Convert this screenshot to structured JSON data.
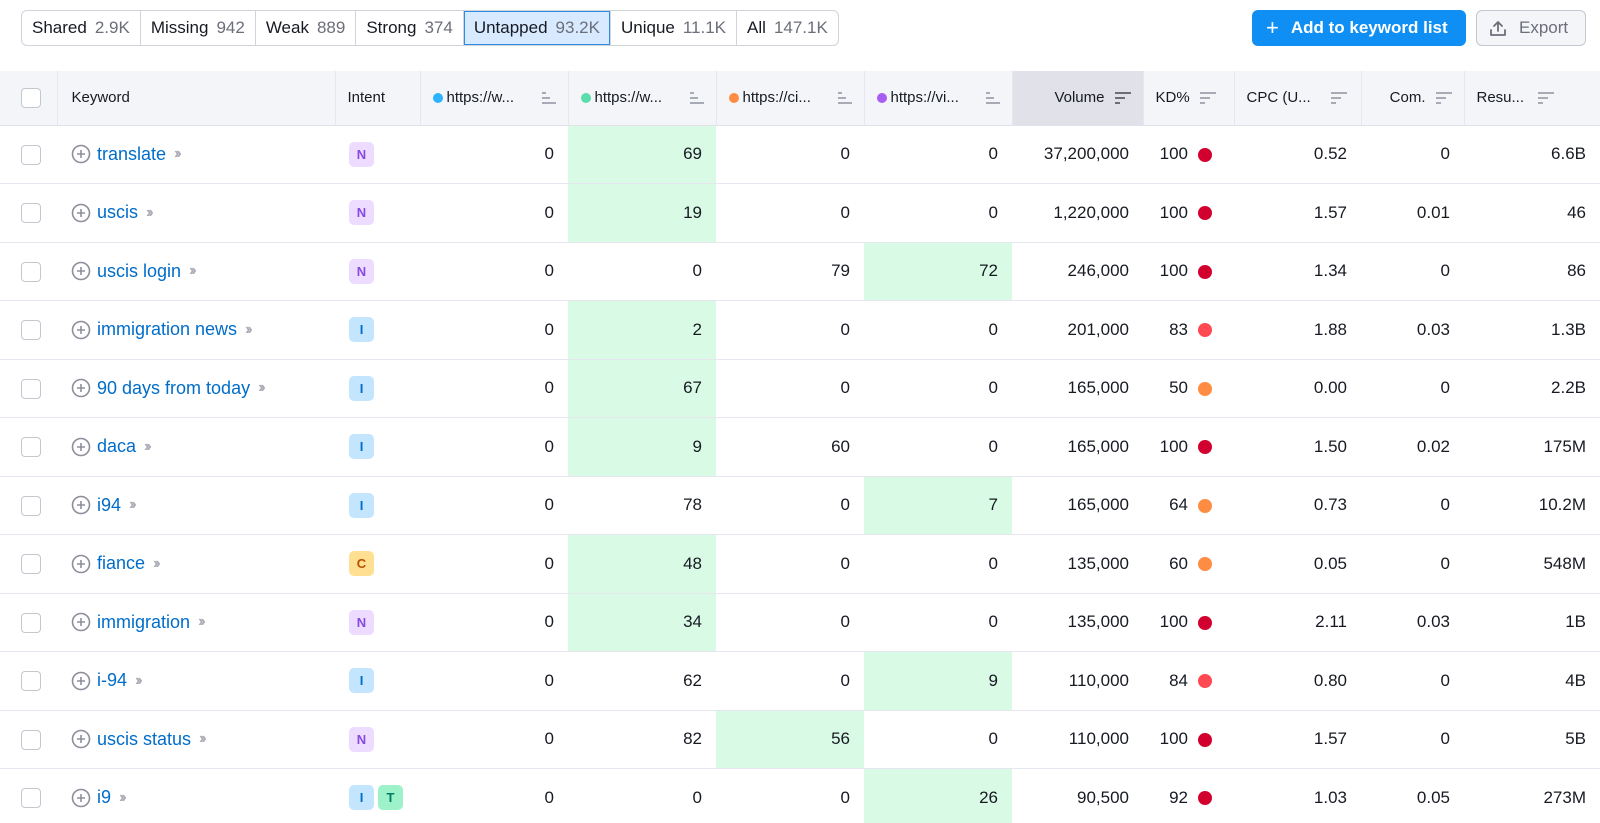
{
  "filters": [
    {
      "label": "Shared",
      "count": "2.9K",
      "active": false
    },
    {
      "label": "Missing",
      "count": "942",
      "active": false
    },
    {
      "label": "Weak",
      "count": "889",
      "active": false
    },
    {
      "label": "Strong",
      "count": "374",
      "active": false
    },
    {
      "label": "Untapped",
      "count": "93.2K",
      "active": true
    },
    {
      "label": "Unique",
      "count": "11.1K",
      "active": false
    },
    {
      "label": "All",
      "count": "147.1K",
      "active": false
    }
  ],
  "actions": {
    "add_label": "Add to keyword list",
    "add_icon": "plus-icon",
    "export_label": "Export",
    "export_icon": "upload-icon"
  },
  "colors": {
    "accent": "#0f8ff3",
    "highlight": "#d9fbe6",
    "domain1": "#2bb3ff",
    "domain2": "#59ddaa",
    "domain3": "#ff8c43",
    "domain4": "#a75cf2",
    "kd_very_hard": "#d1002f",
    "kd_hard": "#ff4953",
    "kd_difficult": "#ff8c43"
  },
  "columns": {
    "keyword": "Keyword",
    "intent": "Intent",
    "domain1": "https://w...",
    "domain2": "https://w...",
    "domain3": "https://ci...",
    "domain4": "https://vi...",
    "volume": "Volume",
    "kd": "KD%",
    "cpc": "CPC (U...",
    "com": "Com.",
    "results": "Resu..."
  },
  "rows": [
    {
      "keyword": "translate",
      "intents": [
        "N"
      ],
      "d1": "0",
      "d2": "69",
      "d3": "0",
      "d4": "0",
      "hl": 2,
      "volume": "37,200,000",
      "kd": "100",
      "kd_level": "very_hard",
      "cpc": "0.52",
      "com": "0",
      "results": "6.6B"
    },
    {
      "keyword": "uscis",
      "intents": [
        "N"
      ],
      "d1": "0",
      "d2": "19",
      "d3": "0",
      "d4": "0",
      "hl": 2,
      "volume": "1,220,000",
      "kd": "100",
      "kd_level": "very_hard",
      "cpc": "1.57",
      "com": "0.01",
      "results": "46"
    },
    {
      "keyword": "uscis login",
      "intents": [
        "N"
      ],
      "d1": "0",
      "d2": "0",
      "d3": "79",
      "d4": "72",
      "hl": 4,
      "volume": "246,000",
      "kd": "100",
      "kd_level": "very_hard",
      "cpc": "1.34",
      "com": "0",
      "results": "86"
    },
    {
      "keyword": "immigration news",
      "intents": [
        "I"
      ],
      "d1": "0",
      "d2": "2",
      "d3": "0",
      "d4": "0",
      "hl": 2,
      "volume": "201,000",
      "kd": "83",
      "kd_level": "hard",
      "cpc": "1.88",
      "com": "0.03",
      "results": "1.3B"
    },
    {
      "keyword": "90 days from today",
      "intents": [
        "I"
      ],
      "d1": "0",
      "d2": "67",
      "d3": "0",
      "d4": "0",
      "hl": 2,
      "volume": "165,000",
      "kd": "50",
      "kd_level": "difficult",
      "cpc": "0.00",
      "com": "0",
      "results": "2.2B"
    },
    {
      "keyword": "daca",
      "intents": [
        "I"
      ],
      "d1": "0",
      "d2": "9",
      "d3": "60",
      "d4": "0",
      "hl": 2,
      "volume": "165,000",
      "kd": "100",
      "kd_level": "very_hard",
      "cpc": "1.50",
      "com": "0.02",
      "results": "175M"
    },
    {
      "keyword": "i94",
      "intents": [
        "I"
      ],
      "d1": "0",
      "d2": "78",
      "d3": "0",
      "d4": "7",
      "hl": 4,
      "volume": "165,000",
      "kd": "64",
      "kd_level": "difficult",
      "cpc": "0.73",
      "com": "0",
      "results": "10.2M"
    },
    {
      "keyword": "fiance",
      "intents": [
        "C"
      ],
      "d1": "0",
      "d2": "48",
      "d3": "0",
      "d4": "0",
      "hl": 2,
      "volume": "135,000",
      "kd": "60",
      "kd_level": "difficult",
      "cpc": "0.05",
      "com": "0",
      "results": "548M"
    },
    {
      "keyword": "immigration",
      "intents": [
        "N"
      ],
      "d1": "0",
      "d2": "34",
      "d3": "0",
      "d4": "0",
      "hl": 2,
      "volume": "135,000",
      "kd": "100",
      "kd_level": "very_hard",
      "cpc": "2.11",
      "com": "0.03",
      "results": "1B"
    },
    {
      "keyword": "i-94",
      "intents": [
        "I"
      ],
      "d1": "0",
      "d2": "62",
      "d3": "0",
      "d4": "9",
      "hl": 4,
      "volume": "110,000",
      "kd": "84",
      "kd_level": "hard",
      "cpc": "0.80",
      "com": "0",
      "results": "4B"
    },
    {
      "keyword": "uscis status",
      "intents": [
        "N"
      ],
      "d1": "0",
      "d2": "82",
      "d3": "56",
      "d4": "0",
      "hl": 3,
      "volume": "110,000",
      "kd": "100",
      "kd_level": "very_hard",
      "cpc": "1.57",
      "com": "0",
      "results": "5B"
    },
    {
      "keyword": "i9",
      "intents": [
        "I",
        "T"
      ],
      "d1": "0",
      "d2": "0",
      "d3": "0",
      "d4": "26",
      "hl": 4,
      "volume": "90,500",
      "kd": "92",
      "kd_level": "very_hard",
      "cpc": "1.03",
      "com": "0.05",
      "results": "273M"
    }
  ]
}
